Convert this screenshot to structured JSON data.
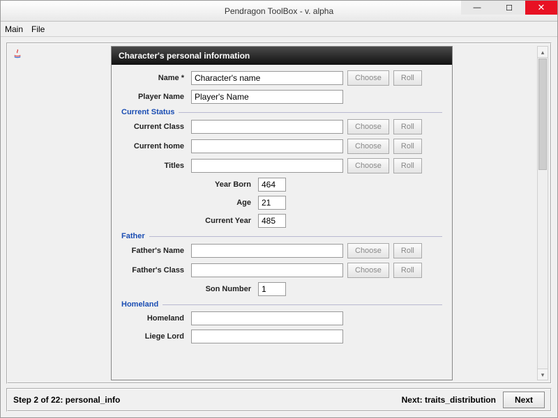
{
  "window": {
    "title": "Pendragon ToolBox - v. alpha"
  },
  "menu": {
    "main": "Main",
    "file": "File"
  },
  "panel": {
    "header": "Character's personal information"
  },
  "labels": {
    "name": "Name *",
    "player_name": "Player Name",
    "current_status": "Current Status",
    "current_class": "Current Class",
    "current_home": "Current home",
    "titles": "Titles",
    "year_born": "Year Born",
    "age": "Age",
    "current_year": "Current Year",
    "father": "Father",
    "fathers_name": "Father's Name",
    "fathers_class": "Father's Class",
    "son_number": "Son Number",
    "homeland_section": "Homeland",
    "homeland": "Homeland",
    "liege_lord": "Liege Lord"
  },
  "fields": {
    "name": "Character's name",
    "player_name": "Player's Name",
    "current_class": "",
    "current_home": "",
    "titles": "",
    "year_born": "464",
    "age": "21",
    "current_year": "485",
    "fathers_name": "",
    "fathers_class": "",
    "son_number": "1",
    "homeland": "",
    "liege_lord": ""
  },
  "buttons": {
    "choose": "Choose",
    "roll": "Roll",
    "next": "Next"
  },
  "footer": {
    "step": "Step 2 of 22: personal_info",
    "next": "Next: traits_distribution"
  }
}
